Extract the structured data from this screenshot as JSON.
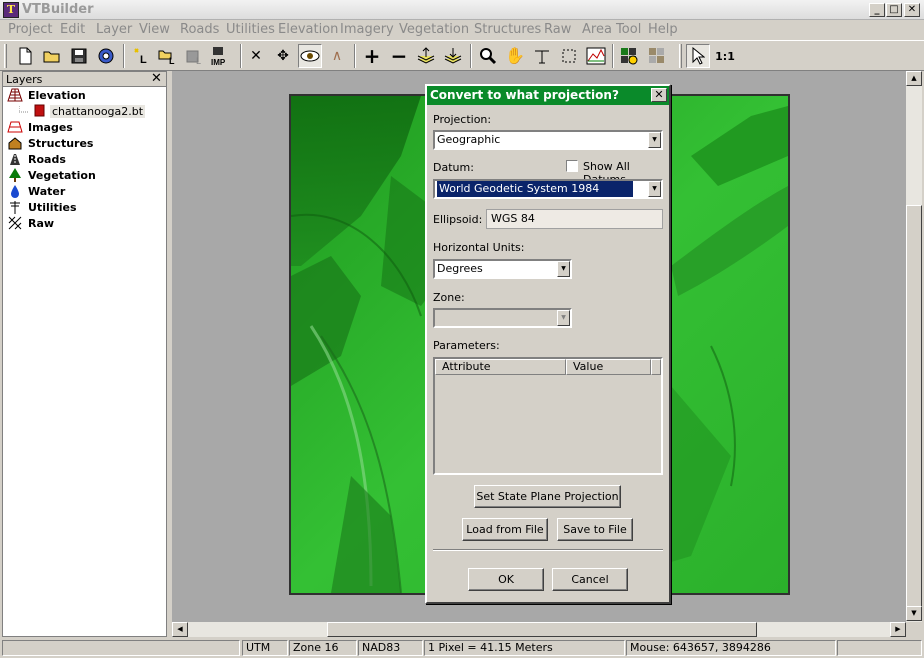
{
  "window": {
    "title": "VTBuilder",
    "app_icon_glyph": "T"
  },
  "menu": [
    "Project",
    "Edit",
    "Layer",
    "View",
    "Roads",
    "Utilities",
    "Elevation",
    "Imagery",
    "Vegetation",
    "Structures",
    "Raw",
    "Area Tool",
    "Help"
  ],
  "toolbar": {
    "zoom_one_label": "1:1",
    "imp_label": "IMP"
  },
  "layers_panel": {
    "title": "Layers",
    "items": [
      {
        "label": "Elevation",
        "icon": "elevation-grid-icon"
      },
      {
        "label": "Images",
        "icon": "images-icon"
      },
      {
        "label": "Structures",
        "icon": "house-icon"
      },
      {
        "label": "Roads",
        "icon": "roads-icon"
      },
      {
        "label": "Vegetation",
        "icon": "tree-icon"
      },
      {
        "label": "Water",
        "icon": "water-drop-icon"
      },
      {
        "label": "Utilities",
        "icon": "utility-pole-icon"
      },
      {
        "label": "Raw",
        "icon": "raw-hatch-icon"
      }
    ],
    "elevation_child": "chattanooga2.bt"
  },
  "dialog": {
    "title": "Convert to what projection?",
    "projection_label": "Projection:",
    "projection_value": "Geographic",
    "datum_label": "Datum:",
    "show_all_datums_label": "Show All Datums",
    "show_all_datums_checked": false,
    "datum_value": "World Geodetic System 1984",
    "ellipsoid_label": "Ellipsoid:",
    "ellipsoid_value": "WGS 84",
    "horizontal_units_label": "Horizontal Units:",
    "horizontal_units_value": "Degrees",
    "zone_label": "Zone:",
    "parameters_label": "Parameters:",
    "col_attribute": "Attribute",
    "col_value": "Value",
    "state_plane_button": "Set State Plane Projection",
    "load_button": "Load from File",
    "save_button": "Save to File",
    "ok_button": "OK",
    "cancel_button": "Cancel"
  },
  "status_bar": {
    "projection": "UTM",
    "zone": "Zone 16",
    "datum": "NAD83",
    "pixel_size": "1 Pixel = 41.15 Meters",
    "mouse": "Mouse: 643657, 3894286"
  },
  "colors": {
    "dialog_title_bg": "#0a8a2a",
    "terrain_green": "#2fb82f",
    "selected_datum_bg": "#0a246a"
  }
}
